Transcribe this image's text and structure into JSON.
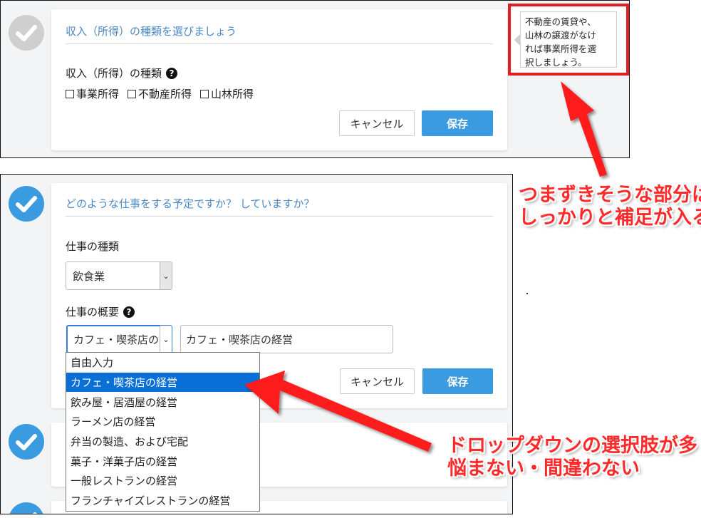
{
  "top_panel": {
    "title": "収入（所得）の種類を選びましょう",
    "field_label": "収入（所得）の種類",
    "help_icon": "?",
    "checkbox_options": [
      "事業所得",
      "不動産所得",
      "山林所得"
    ],
    "cancel_label": "キャンセル",
    "save_label": "保存"
  },
  "tooltip": {
    "lines": [
      "不動産の賃貸や、",
      "山林の譲渡がなけ",
      "れば事業所得を選",
      "択しましょう。"
    ]
  },
  "bottom_panel": {
    "title": "どのような仕事をする予定ですか？ していますか？",
    "job_type_label": "仕事の種類",
    "job_type_value": "飲食業",
    "job_summary_label": "仕事の概要",
    "help_icon": "?",
    "job_summary_select_value": "カフェ・喫茶店の",
    "job_summary_text_value": "カフェ・喫茶店の経営",
    "cancel_label": "キャンセル",
    "save_label": "保存",
    "dropdown_options": [
      "自由入力",
      "カフェ・喫茶店の経営",
      "飲み屋・居酒屋の経営",
      "ラーメン店の経営",
      "弁当の製造、および宅配",
      "菓子・洋菓子店の経営",
      "一般レストランの経営",
      "フランチャイズレストランの経営"
    ],
    "dropdown_selected": "カフェ・喫茶店の経営"
  },
  "annotations": {
    "callout_top": [
      "つまずきそうな部分は",
      "しっかりと補足が入る"
    ],
    "callout_bottom": [
      "ドロップダウンの選択肢が多く",
      "悩まない・間違わない"
    ],
    "annotation_color": "#ff2a2a"
  },
  "icons": {
    "step_check": "check-circle-icon",
    "dropdown_arrow": "chevron-down-icon"
  }
}
